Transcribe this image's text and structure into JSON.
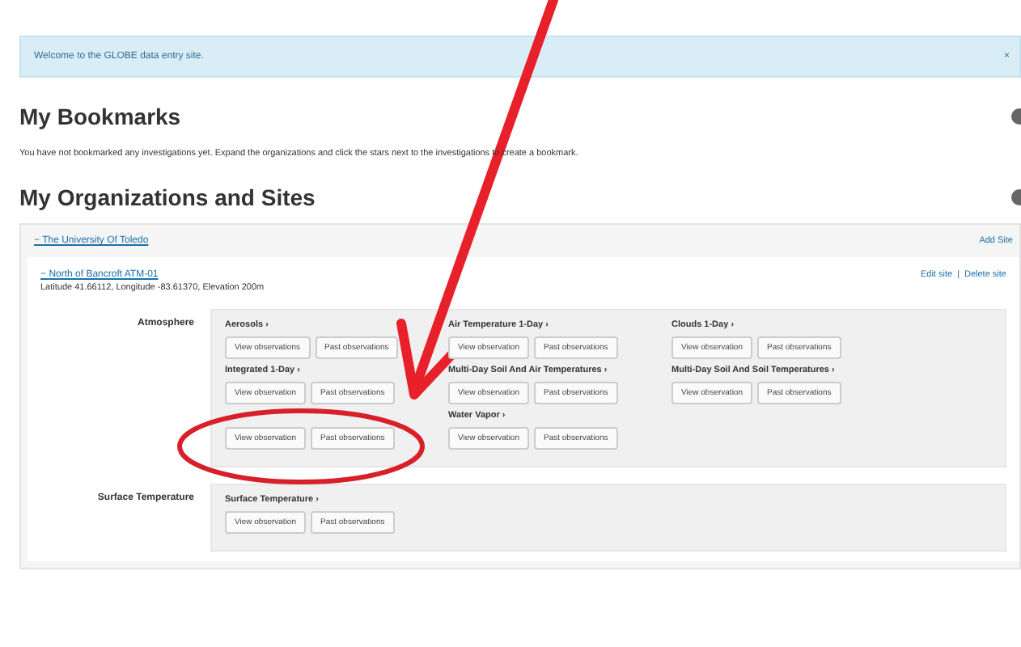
{
  "banner": {
    "text": "Welcome to the GLOBE data entry site.",
    "close": "×"
  },
  "bookmarks": {
    "title": "My Bookmarks",
    "text": "You have not bookmarked any investigations yet. Expand the organizations and click the stars next to the investigations to create a bookmark."
  },
  "organizations": {
    "title": "My Organizations and Sites",
    "org": {
      "toggle": "−",
      "name": "The University Of Toledo",
      "add_site": "Add Site",
      "site": {
        "toggle": "−",
        "name": "North of Bancroft ATM-01",
        "location": "Latitude 41.66112, Longitude -83.61370, Elevation 200m",
        "edit": "Edit site",
        "separator": "|",
        "delete": "Delete site",
        "groups": [
          {
            "label": "Atmosphere",
            "protocols": [
              {
                "title": "Aerosols",
                "arrow": "›",
                "buttons": [
                  "View observations",
                  "Past observations"
                ]
              },
              {
                "title": "Air Temperature 1-Day",
                "arrow": "›",
                "buttons": [
                  "View observation",
                  "Past observations"
                ]
              },
              {
                "title": "Clouds 1-Day",
                "arrow": "›",
                "buttons": [
                  "View observation",
                  "Past observations"
                ]
              },
              {
                "title": "Integrated 1-Day",
                "arrow": "›",
                "buttons": [
                  "View observation",
                  "Past observations"
                ]
              },
              {
                "title": "Multi-Day Soil And Air Temperatures",
                "arrow": "›",
                "buttons": [
                  "View observation",
                  "Past observations"
                ]
              },
              {
                "title": "Multi-Day Soil And Soil Temperatures",
                "arrow": "›",
                "buttons": [
                  "View observation",
                  "Past observations"
                ]
              },
              {
                "buttons": [
                  "View observation",
                  "Past observations"
                ]
              },
              {
                "title": "Water Vapor",
                "arrow": "›",
                "buttons": [
                  "View observation",
                  "Past observations"
                ]
              }
            ]
          },
          {
            "label": "Surface Temperature",
            "protocols": [
              {
                "title": "Surface Temperature",
                "arrow": "›",
                "buttons": [
                  "View observation",
                  "Past observations"
                ]
              }
            ]
          }
        ]
      }
    }
  },
  "annotation": {
    "arrow": true,
    "circle": true
  }
}
